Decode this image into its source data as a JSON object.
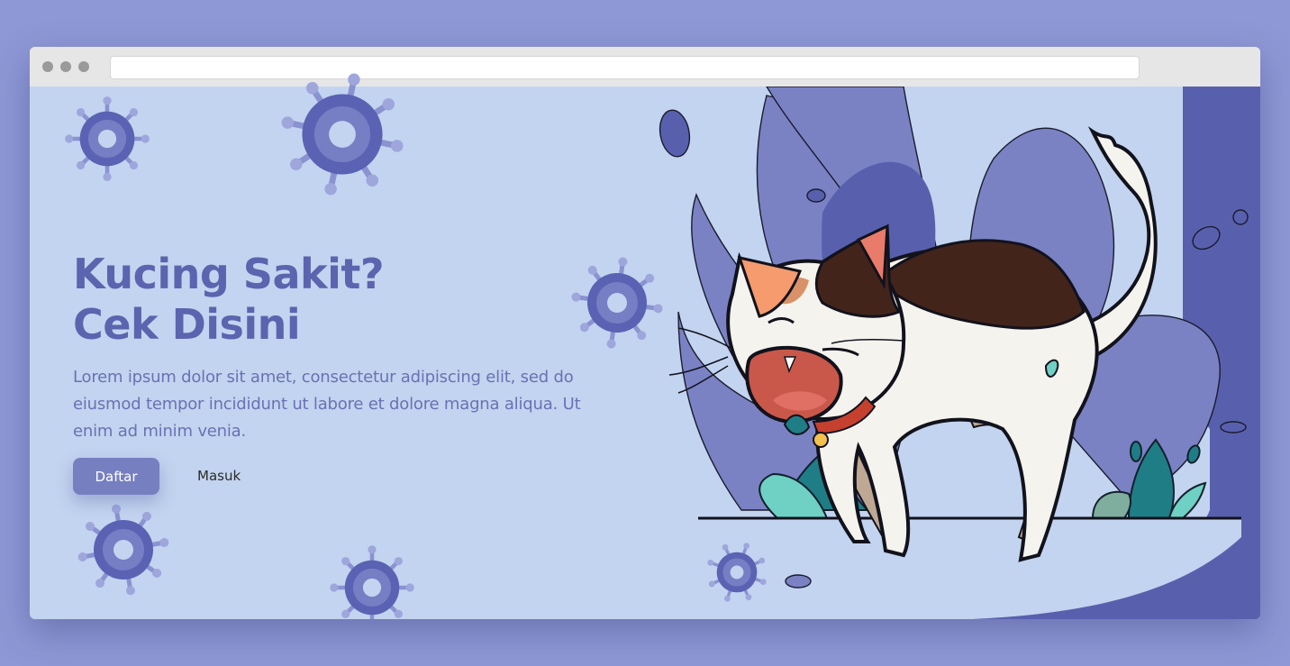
{
  "browser": {
    "url": "",
    "window_dots": [
      "close",
      "minimize",
      "maximize"
    ]
  },
  "hero": {
    "title_line1": "Kucing Sakit?",
    "title_line2": "Cek Disini",
    "description": "Lorem ipsum dolor sit amet, consectetur adipiscing elit, sed do eiusmod tempor incididunt ut labore et dolore magna aliqua. Ut enim ad minim venia.",
    "primary_button": "Daftar",
    "secondary_button": "Masuk"
  },
  "colors": {
    "page_background": "#8f98d6",
    "content_background": "#c2d4ef",
    "accent": "#5b64ae",
    "button": "#767fc0",
    "virus": "#5a62b3",
    "illustration_bg": "#5860ae"
  },
  "decorations": {
    "virus_icon": "virus-icon",
    "illustration": "sick-cat-illustration"
  }
}
